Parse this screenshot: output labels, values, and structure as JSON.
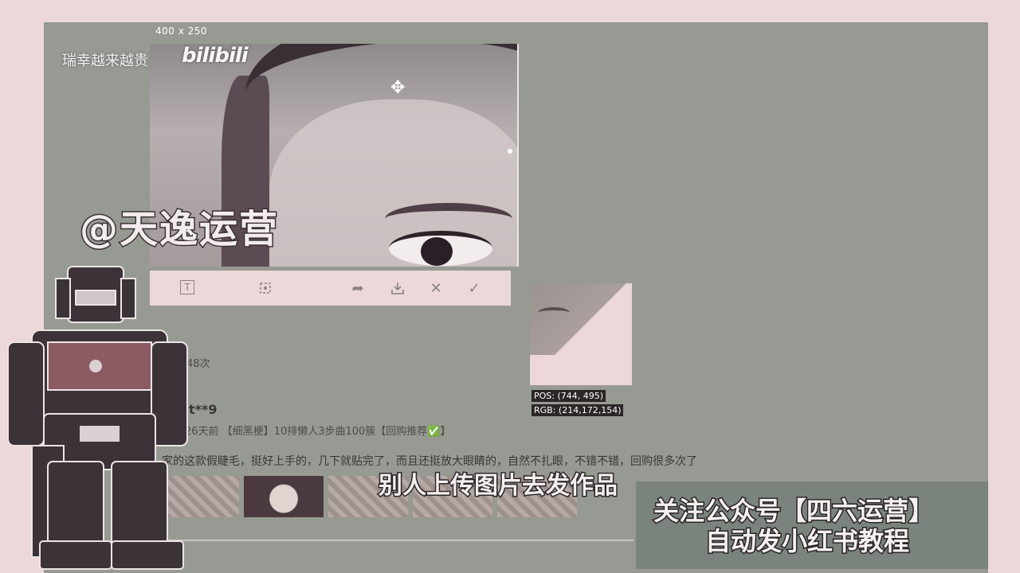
{
  "watermark": {
    "channel": "瑞幸越来越贵",
    "site_logo": "bilibili",
    "handle": "@天逸运营"
  },
  "capture": {
    "size_label": "400 x 250"
  },
  "toolbar": {
    "icons": [
      "text-icon",
      "mosaic-icon",
      "share-icon",
      "download-icon",
      "close-icon",
      "confirm-icon"
    ]
  },
  "review": {
    "views": "48次",
    "username": "t**9",
    "meta": "26天前 【细黑梗】10排懒人3步曲100簇【回购推荐✅】",
    "text": "家的这款假睫毛，挺好上手的，几下就贴完了，而且还挺放大眼睛的，自然不扎眼，不错不错，回购很多次了"
  },
  "magnifier": {
    "pos": "POS: (744, 495)",
    "rgb": "RGB: (214,172,154)"
  },
  "subtitle": "别人上传图片去发作品",
  "promo": {
    "line1": "关注公众号【四六运营】",
    "line2": "自动发小红书教程"
  },
  "colors": {
    "background": "#ecd7d9",
    "panel": "#979a92",
    "promo_box": "#7b847c"
  }
}
